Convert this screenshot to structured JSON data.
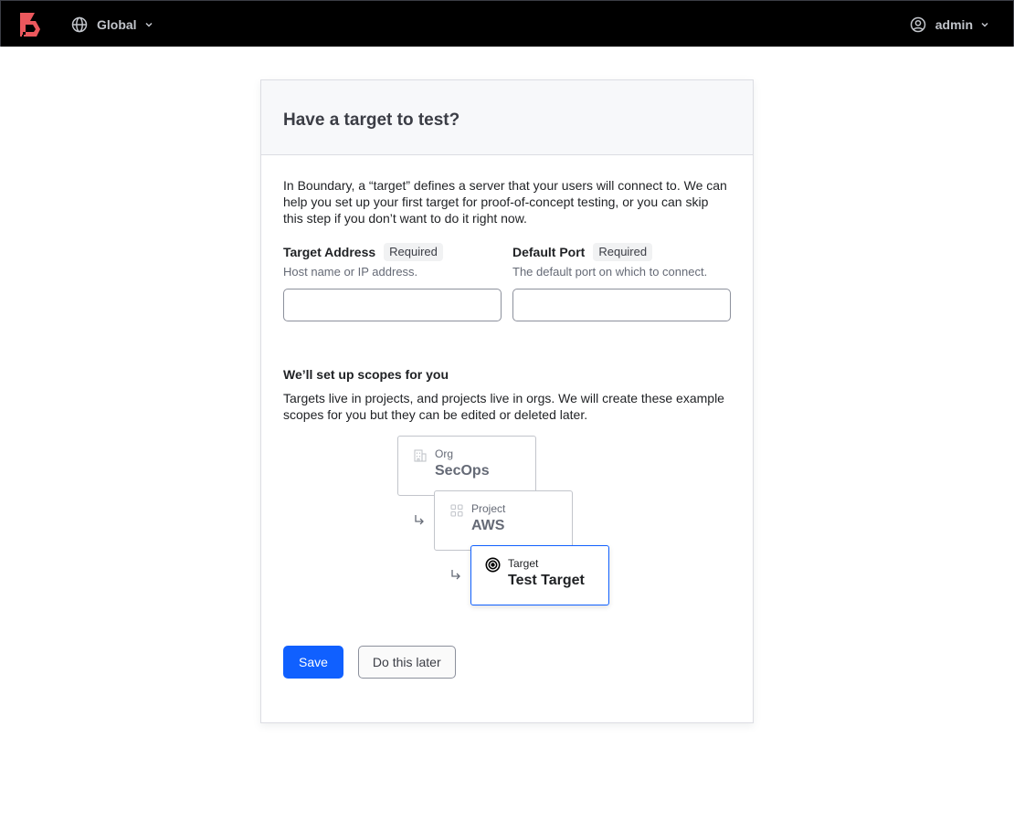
{
  "topbar": {
    "scope_label": "Global",
    "user_label": "admin",
    "brand_color": "#ec585d"
  },
  "card": {
    "title": "Have a target to test?",
    "intro": "In Boundary, a “target” defines a server that your users will connect to. We can help you set up your first target for proof-of-concept testing, or you can skip this step if you don’t want to do it right now.",
    "fields": [
      {
        "label": "Target Address",
        "badge": "Required",
        "help": "Host name or IP address.",
        "value": "",
        "placeholder": ""
      },
      {
        "label": "Default Port",
        "badge": "Required",
        "help": "The default port on which to connect.",
        "value": "",
        "placeholder": ""
      }
    ],
    "scopes_title": "We’ll set up scopes for you",
    "scopes_desc": "Targets live in projects, and projects live in orgs. We will create these example scopes for you but they can be edited or deleted later.",
    "scopes": [
      {
        "type": "Org",
        "name": "SecOps",
        "icon": "building-icon"
      },
      {
        "type": "Project",
        "name": "AWS",
        "icon": "grid-icon"
      },
      {
        "type": "Target",
        "name": "Test Target",
        "icon": "target-icon"
      }
    ],
    "save_label": "Save",
    "later_label": "Do this later",
    "accent_color": "#1060ff"
  }
}
